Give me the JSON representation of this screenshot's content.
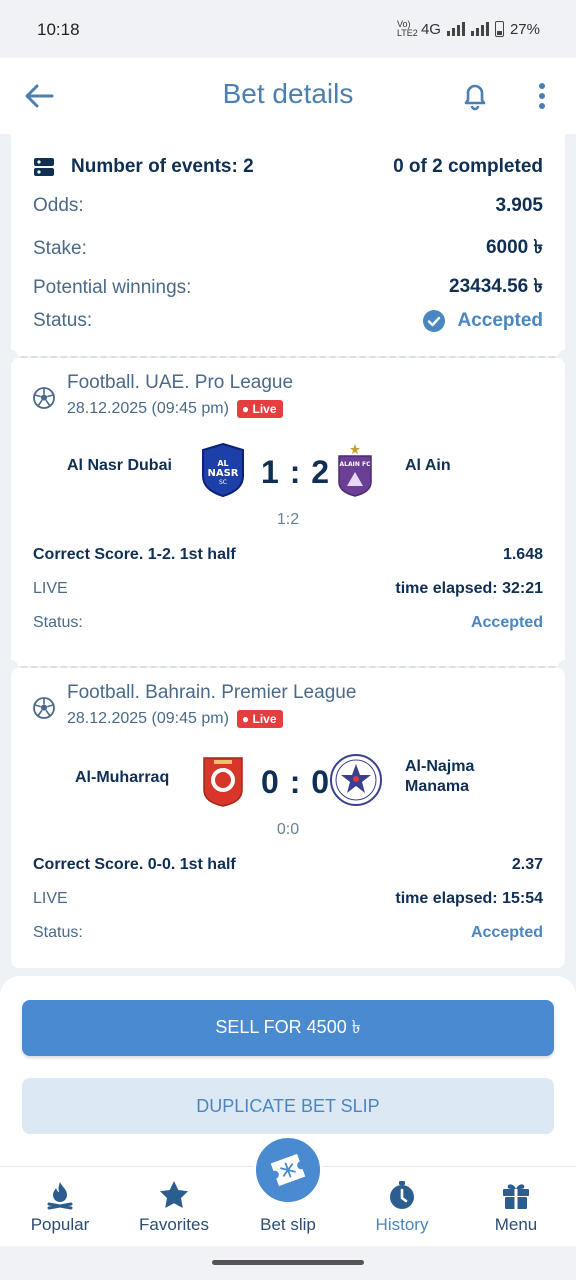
{
  "status_bar": {
    "time": "10:18",
    "network": "4G",
    "volte": "Vo) LTE2",
    "battery": "27%"
  },
  "header": {
    "title": "Bet details"
  },
  "summary": {
    "events_label": "Number of events: 2",
    "completed": "0 of 2 completed",
    "odds_label": "Odds:",
    "odds_value": "3.905",
    "stake_label": "Stake:",
    "stake_value": "6000 ৳",
    "winnings_label": "Potential winnings:",
    "winnings_value": "23434.56 ৳",
    "status_label": "Status:",
    "status_value": "Accepted"
  },
  "events": [
    {
      "league": "Football. UAE. Pro League",
      "date": "28.12.2025 (09:45 pm)",
      "live_badge": "Live",
      "home": "Al Nasr Dubai",
      "away": "Al Ain",
      "score": "1 : 2",
      "subscore": "1:2",
      "bet": "Correct Score. 1-2. 1st half",
      "bet_odds": "1.648",
      "live_label": "LIVE",
      "elapsed": "time elapsed: 32:21",
      "status_label": "Status:",
      "status_value": "Accepted",
      "home_logo_text": [
        "AL",
        "NASR",
        "SC"
      ],
      "away_logo_text": "ALAIN FC"
    },
    {
      "league": "Football. Bahrain. Premier League",
      "date": "28.12.2025 (09:45 pm)",
      "live_badge": "Live",
      "home": "Al-Muharraq",
      "away_line1": "Al-Najma",
      "away_line2": "Manama",
      "score": "0 : 0",
      "subscore": "0:0",
      "bet": "Correct Score. 0-0. 1st half",
      "bet_odds": "2.37",
      "live_label": "LIVE",
      "elapsed": "time elapsed: 15:54",
      "status_label": "Status:",
      "status_value": "Accepted"
    }
  ],
  "actions": {
    "sell": "SELL FOR 4500 ৳",
    "duplicate": "DUPLICATE BET SLIP"
  },
  "nav": {
    "popular": "Popular",
    "favorites": "Favorites",
    "betslip": "Bet slip",
    "history": "History",
    "menu": "Menu"
  },
  "colors": {
    "accent": "#4a8ad0",
    "live": "#e63e3e",
    "text_dark": "#0f2f54",
    "text_muted": "#4a6a8a"
  },
  "icons": [
    "arrow-back-icon",
    "bell-icon",
    "more-vertical-icon",
    "events-list-icon",
    "check-circle-icon",
    "football-icon",
    "campfire-icon",
    "star-icon",
    "ticket-snowflake-icon",
    "stopwatch-icon",
    "gift-icon"
  ]
}
